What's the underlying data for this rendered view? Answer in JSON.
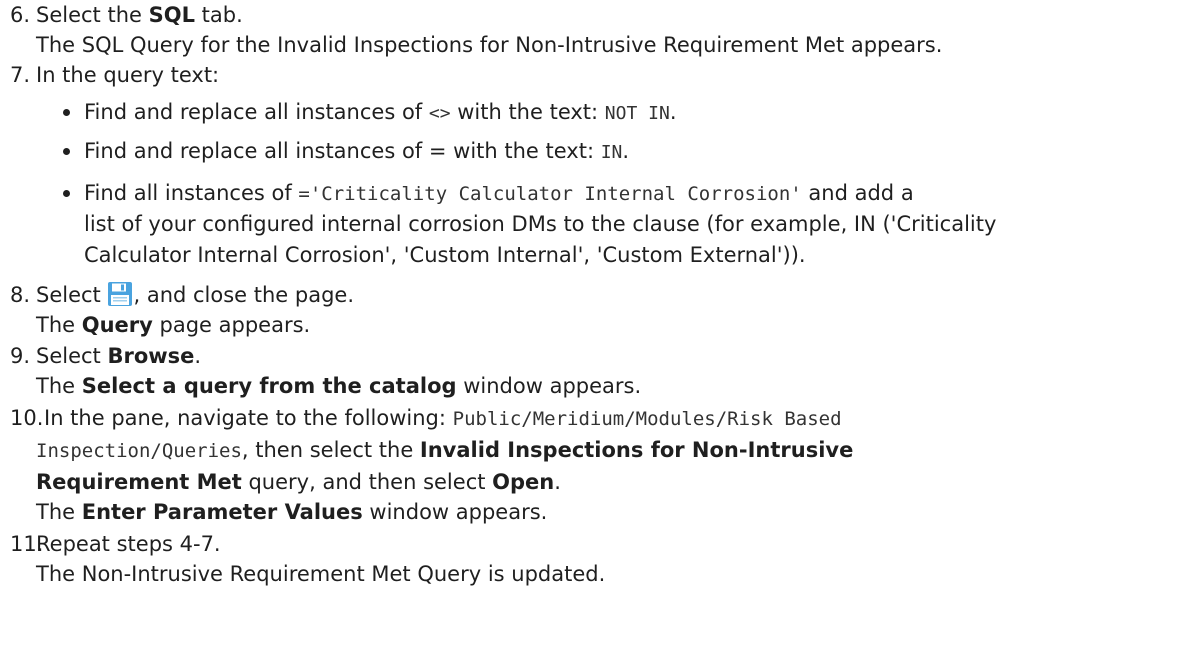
{
  "steps": {
    "s6": {
      "num": "6.",
      "pre": "Select the ",
      "bold": "SQL",
      "post": " tab.",
      "result": "The SQL Query for the Invalid Inspections for Non-Intrusive Requirement Met appears."
    },
    "s7": {
      "num": "7.",
      "text": "In the query text:",
      "bullets": {
        "b1": {
          "pre": "Find and replace all instances of ",
          "code1": "<>",
          "mid": " with the text: ",
          "code2": "NOT IN",
          "post": "."
        },
        "b2": {
          "pre": "Find and replace all instances of ",
          "sym": "=",
          "mid": " with the text: ",
          "code2": "IN",
          "post": "."
        },
        "b3": {
          "pre": "Find all instances of ",
          "code": "='Criticality Calculator Internal Corrosion'",
          "post": " and add a",
          "line2": "list of your configured internal corrosion DMs to the clause (for example, IN ('Criticality",
          "line3": "Calculator Internal Corrosion', 'Custom Internal', 'Custom External'))."
        }
      }
    },
    "s8": {
      "num": "8.",
      "pre": "Select ",
      "post": ", and close the page.",
      "result_pre": "The ",
      "result_bold": "Query",
      "result_post": " page appears."
    },
    "s9": {
      "num": "9.",
      "pre": "Select ",
      "bold": "Browse",
      "post": ".",
      "result_pre": "The ",
      "result_bold": "Select a query from the catalog",
      "result_post": " window appears."
    },
    "s10": {
      "num": "10.",
      "pre": "In the pane, navigate to the following: ",
      "path1": "Public/Meridium/Modules/Risk Based",
      "path2": "Inspection/Queries",
      "mid": ", then select the ",
      "bold1": "Invalid Inspections for Non-Intrusive",
      "bold2": "Requirement Met",
      "mid2": " query, and then select ",
      "bold3": "Open",
      "post": ".",
      "result_pre": "The ",
      "result_bold": "Enter Parameter Values",
      "result_post": " window appears."
    },
    "s11": {
      "num": "11.",
      "text": "Repeat steps 4-7.",
      "result": "The Non-Intrusive Requirement Met Query is updated."
    }
  },
  "icons": {
    "save": "save-icon"
  },
  "colors": {
    "text": "#1f1f1f",
    "save_icon": "#4aa3df"
  }
}
